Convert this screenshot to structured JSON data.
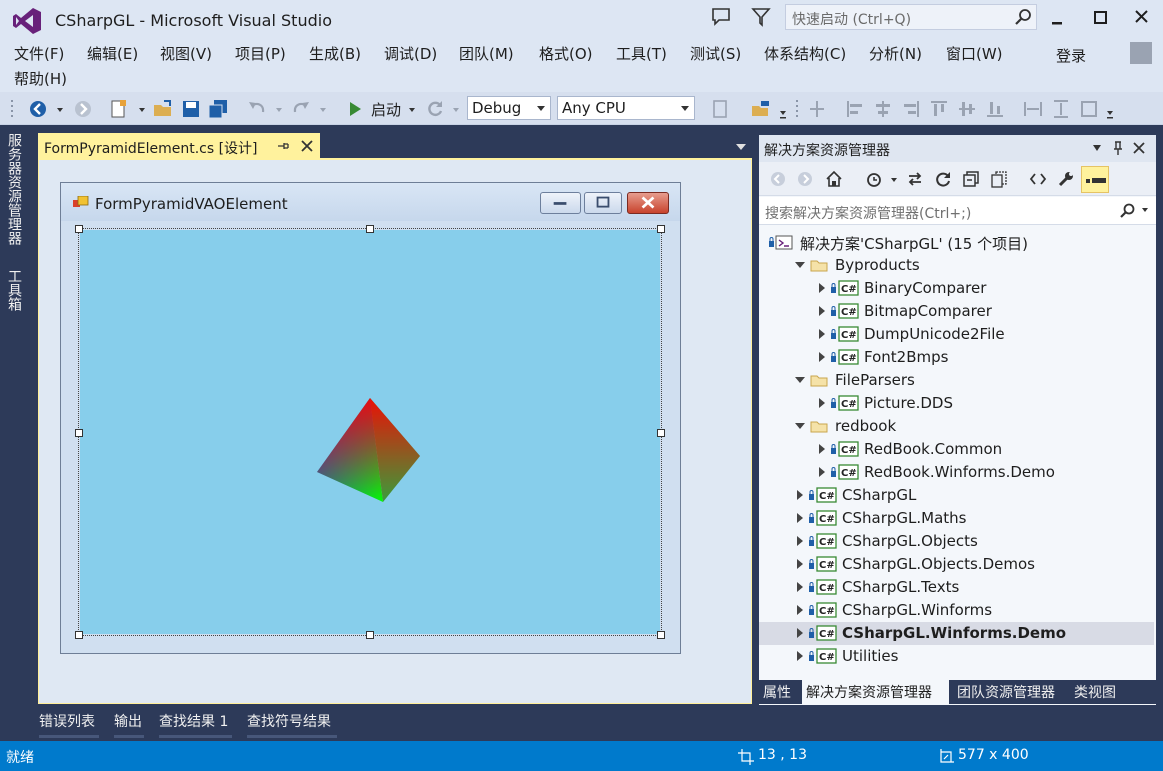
{
  "title": "CSharpGL - Microsoft Visual Studio",
  "quick_launch": {
    "placeholder": "快速启动 (Ctrl+Q)"
  },
  "menu": [
    "文件(F)",
    "编辑(E)",
    "视图(V)",
    "项目(P)",
    "生成(B)",
    "调试(D)",
    "团队(M)",
    "格式(O)",
    "工具(T)",
    "测试(S)",
    "体系结构(C)",
    "分析(N)",
    "窗口(W)",
    "帮助(H)"
  ],
  "login": "登录",
  "toolbar": {
    "start_label": "启动",
    "config": "Debug",
    "platform": "Any CPU"
  },
  "side_tabs": [
    "服务器资源管理器",
    "工具箱"
  ],
  "document": {
    "tab_label": "FormPyramidElement.cs [设计]",
    "form_title": "FormPyramidVAOElement"
  },
  "solution_explorer": {
    "title": "解决方案资源管理器",
    "search_placeholder": "搜索解决方案资源管理器(Ctrl+;)",
    "items": [
      {
        "label": "解决方案'CSharpGL' (15 个项目)",
        "level": 0,
        "kind": "solution",
        "expander": "none"
      },
      {
        "label": "Byproducts",
        "level": 1,
        "kind": "folder",
        "expander": "expanded"
      },
      {
        "label": "BinaryComparer",
        "level": 2,
        "kind": "csproj",
        "expander": "collapsed"
      },
      {
        "label": "BitmapComparer",
        "level": 2,
        "kind": "csproj",
        "expander": "collapsed"
      },
      {
        "label": "DumpUnicode2File",
        "level": 2,
        "kind": "csproj",
        "expander": "collapsed"
      },
      {
        "label": "Font2Bmps",
        "level": 2,
        "kind": "csproj",
        "expander": "collapsed"
      },
      {
        "label": "FileParsers",
        "level": 1,
        "kind": "folder",
        "expander": "expanded"
      },
      {
        "label": "Picture.DDS",
        "level": 2,
        "kind": "csproj",
        "expander": "collapsed"
      },
      {
        "label": "redbook",
        "level": 1,
        "kind": "folder",
        "expander": "expanded"
      },
      {
        "label": "RedBook.Common",
        "level": 2,
        "kind": "csproj",
        "expander": "collapsed"
      },
      {
        "label": "RedBook.Winforms.Demo",
        "level": 2,
        "kind": "csproj",
        "expander": "collapsed"
      },
      {
        "label": "CSharpGL",
        "level": 1,
        "kind": "csproj",
        "expander": "collapsed"
      },
      {
        "label": "CSharpGL.Maths",
        "level": 1,
        "kind": "csproj",
        "expander": "collapsed"
      },
      {
        "label": "CSharpGL.Objects",
        "level": 1,
        "kind": "csproj",
        "expander": "collapsed"
      },
      {
        "label": "CSharpGL.Objects.Demos",
        "level": 1,
        "kind": "csproj",
        "expander": "collapsed"
      },
      {
        "label": "CSharpGL.Texts",
        "level": 1,
        "kind": "csproj",
        "expander": "collapsed"
      },
      {
        "label": "CSharpGL.Winforms",
        "level": 1,
        "kind": "csproj",
        "expander": "collapsed"
      },
      {
        "label": "CSharpGL.Winforms.Demo",
        "level": 1,
        "kind": "csproj",
        "expander": "collapsed",
        "selected": true,
        "bold": true
      },
      {
        "label": "Utilities",
        "level": 1,
        "kind": "csproj",
        "expander": "collapsed"
      }
    ],
    "tabs": [
      "属性",
      "解决方案资源管理器",
      "团队资源管理器",
      "类视图"
    ]
  },
  "bottom_tabs": [
    "错误列表",
    "输出",
    "查找结果 1",
    "查找符号结果"
  ],
  "status": {
    "text": "就绪",
    "position": "13 , 13",
    "size": "577 x 400"
  },
  "colors": {
    "accent": "#007acc",
    "canvas": "#87ceeb",
    "doc_tab": "#fff29d",
    "chrome": "#dde6f3",
    "frame": "#2d3a59"
  }
}
